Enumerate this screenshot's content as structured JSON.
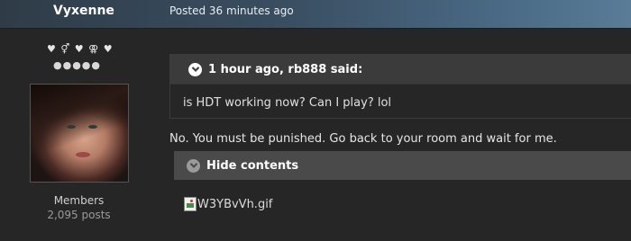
{
  "post": {
    "author": "Vyxenne",
    "date_text": "Posted 36 minutes ago"
  },
  "author_info": {
    "rank_icons": "♥ ⚥ ♥ ⚢ ♥",
    "rank_dots": "●●●●●",
    "group": "Members",
    "post_count": "2,095 posts"
  },
  "quote": {
    "citation": "1 hour ago, rb888 said:",
    "text": "is HDT working now? Can I play? lol"
  },
  "reply": {
    "text": "No. You must be punished. Go back to your room and wait for me."
  },
  "spoiler": {
    "label": "Hide contents",
    "image_alt": "W3YBvVh.gif"
  },
  "colors": {
    "background": "#262626",
    "header_start": "#2f3c48",
    "header_end": "#5a7c97",
    "quote_header": "#3b3b3b",
    "spoiler_header": "#4a4a4a"
  }
}
